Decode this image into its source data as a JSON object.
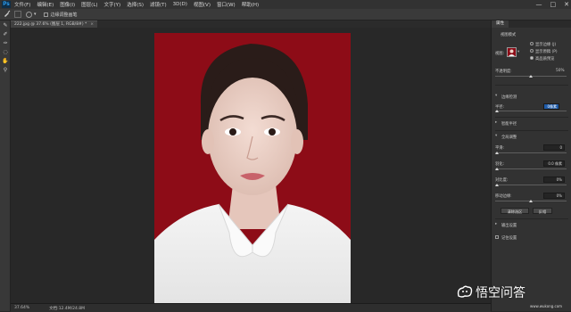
{
  "menubar": {
    "logo": "Ps",
    "items": [
      "文件(F)",
      "编辑(E)",
      "图像(I)",
      "图层(L)",
      "文字(Y)",
      "选择(S)",
      "滤镜(T)",
      "3D(D)",
      "视图(V)",
      "窗口(W)",
      "帮助(H)"
    ],
    "window_controls": [
      "—",
      "□",
      "✕"
    ]
  },
  "options_bar": {
    "checkbox_label": "边缘调整画笔"
  },
  "document_tab": {
    "label": "222.jpg @ 37.6% (图层 1, RGB/8#) *",
    "close": "×"
  },
  "status_bar": {
    "zoom": "37.64%",
    "doc_info": "文档:12.4M/24.8M"
  },
  "panel": {
    "tab_label": "属性",
    "view_mode_header": "视图模式",
    "view_label": "视图:",
    "radio_options": [
      {
        "label": "显示边缘 (J)",
        "selected": false
      },
      {
        "label": "显示原稿 (P)",
        "selected": false
      },
      {
        "label": "高品质预览",
        "selected": true
      }
    ],
    "opacity_label": "不透明度:",
    "opacity_value": "50%",
    "opacity_level": 0.5,
    "edge_detection_header": "边缘检测",
    "radius_label": "半径:",
    "radius_value": "0像素",
    "smart_radius_label": "智能半径",
    "global_refine_header": "全局调整",
    "smooth_label": "平滑:",
    "smooth_value": "0",
    "feather_label": "羽化:",
    "feather_value": "0.0 像素",
    "contrast_label": "对比度:",
    "contrast_value": "0%",
    "shift_edge_label": "移动边缘:",
    "shift_edge_value": "0%",
    "clear_selection_button": "清除选区",
    "invert_button": "反相",
    "output_header": "输出设置",
    "remember_label": "记住设置"
  },
  "watermark": {
    "text": "悟空问答",
    "url": "www.wukong.com"
  },
  "colors": {
    "photo_background": "#8d0c17",
    "accent": "#1f5ba8"
  }
}
